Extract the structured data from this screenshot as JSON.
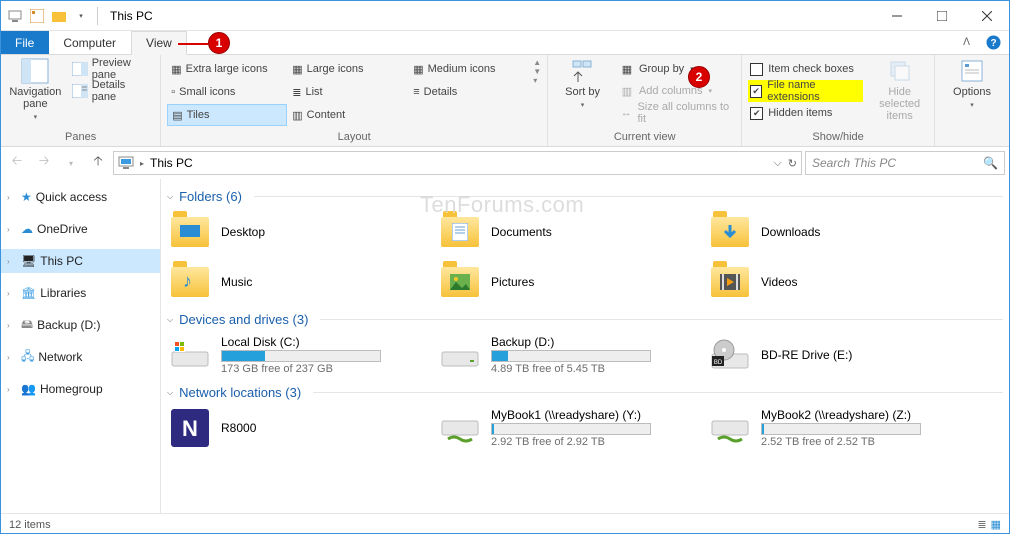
{
  "titlebar": {
    "title": "This PC"
  },
  "tabs": {
    "file": "File",
    "computer": "Computer",
    "view": "View"
  },
  "annotations": {
    "a1": "1",
    "a2": "2"
  },
  "ribbon": {
    "panes": {
      "label": "Panes",
      "nav": "Navigation pane",
      "preview": "Preview pane",
      "details": "Details pane"
    },
    "layout": {
      "label": "Layout",
      "items": [
        "Extra large icons",
        "Large icons",
        "Medium icons",
        "Small icons",
        "List",
        "Details",
        "Tiles",
        "Content"
      ]
    },
    "current": {
      "label": "Current view",
      "sort": "Sort by",
      "group": "Group by",
      "addcols": "Add columns",
      "sizecols": "Size all columns to fit"
    },
    "showhide": {
      "label": "Show/hide",
      "itemcheck": "Item check boxes",
      "fne": "File name extensions",
      "hidden": "Hidden items",
      "hidesel": "Hide selected items"
    },
    "options": "Options"
  },
  "address": {
    "location": "This PC"
  },
  "search": {
    "placeholder": "Search This PC"
  },
  "nav": {
    "quick": "Quick access",
    "onedrive": "OneDrive",
    "thispc": "This PC",
    "libraries": "Libraries",
    "backup": "Backup (D:)",
    "network": "Network",
    "homegroup": "Homegroup"
  },
  "content": {
    "folders_hdr": "Folders (6)",
    "folders": [
      "Desktop",
      "Documents",
      "Downloads",
      "Music",
      "Pictures",
      "Videos"
    ],
    "drives_hdr": "Devices and drives (3)",
    "drives": [
      {
        "name": "Local Disk (C:)",
        "sub": "173 GB free of 237 GB",
        "fill": 27
      },
      {
        "name": "Backup (D:)",
        "sub": "4.89 TB free of 5.45 TB",
        "fill": 10
      },
      {
        "name": "BD-RE Drive (E:)",
        "sub": ""
      }
    ],
    "net_hdr": "Network locations (3)",
    "net": [
      {
        "name": "R8000",
        "sub": ""
      },
      {
        "name": "MyBook1 (\\\\readyshare) (Y:)",
        "sub": "2.92 TB free of 2.92 TB",
        "fill": 1
      },
      {
        "name": "MyBook2 (\\\\readyshare) (Z:)",
        "sub": "2.52 TB free of 2.52 TB",
        "fill": 1
      }
    ]
  },
  "status": {
    "count": "12 items"
  },
  "watermark": "TenForums.com"
}
